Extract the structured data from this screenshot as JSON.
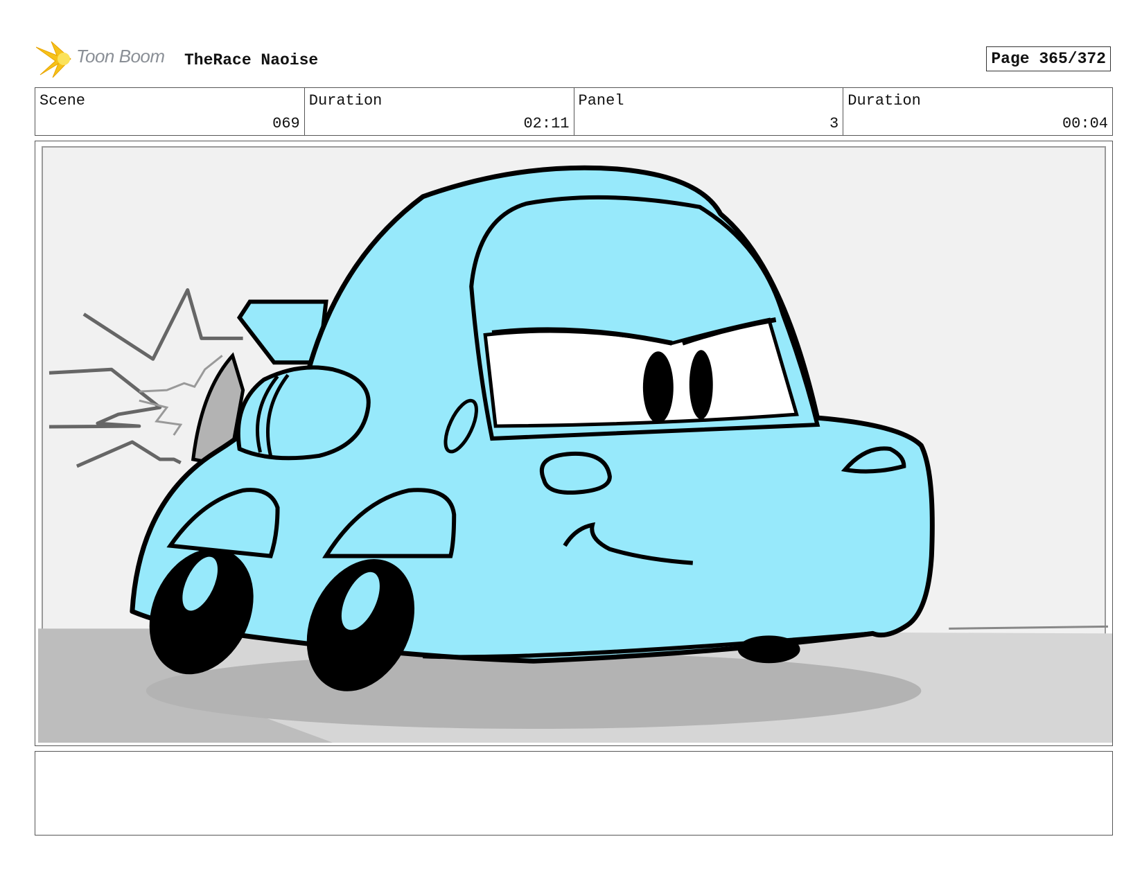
{
  "header": {
    "logo_text": "Toon Boom",
    "project_title": "TheRace Naoise",
    "page_label": "Page 365/372"
  },
  "info": [
    {
      "label": "Scene",
      "value": "069"
    },
    {
      "label": "Duration",
      "value": "02:11"
    },
    {
      "label": "Panel",
      "value": "3"
    },
    {
      "label": "Duration",
      "value": "00:04"
    }
  ],
  "colors": {
    "car_body": "#97e9fb",
    "car_shade": "#6fd0e6",
    "background": "#f1f1f1",
    "ground_shadow": "#b3b3b3",
    "logo_star": "#f6c21a"
  },
  "notes": ""
}
